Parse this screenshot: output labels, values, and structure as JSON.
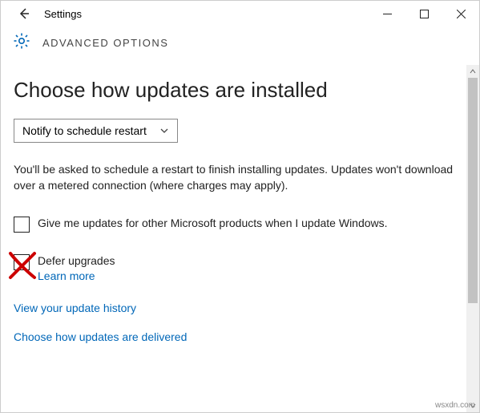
{
  "window": {
    "title": "Settings"
  },
  "header": {
    "subtitle": "ADVANCED OPTIONS"
  },
  "main": {
    "heading": "Choose how updates are installed",
    "dropdown_selected": "Notify to schedule restart",
    "description": "You'll be asked to schedule a restart to finish installing updates. Updates won't download over a metered connection (where charges may apply).",
    "checkbox1_label": "Give me updates for other Microsoft products when I update Windows.",
    "checkbox2_label": "Defer upgrades",
    "learn_more": "Learn more",
    "link_history": "View your update history",
    "link_delivery": "Choose how updates are delivered"
  },
  "watermark": "wsxdn.com"
}
